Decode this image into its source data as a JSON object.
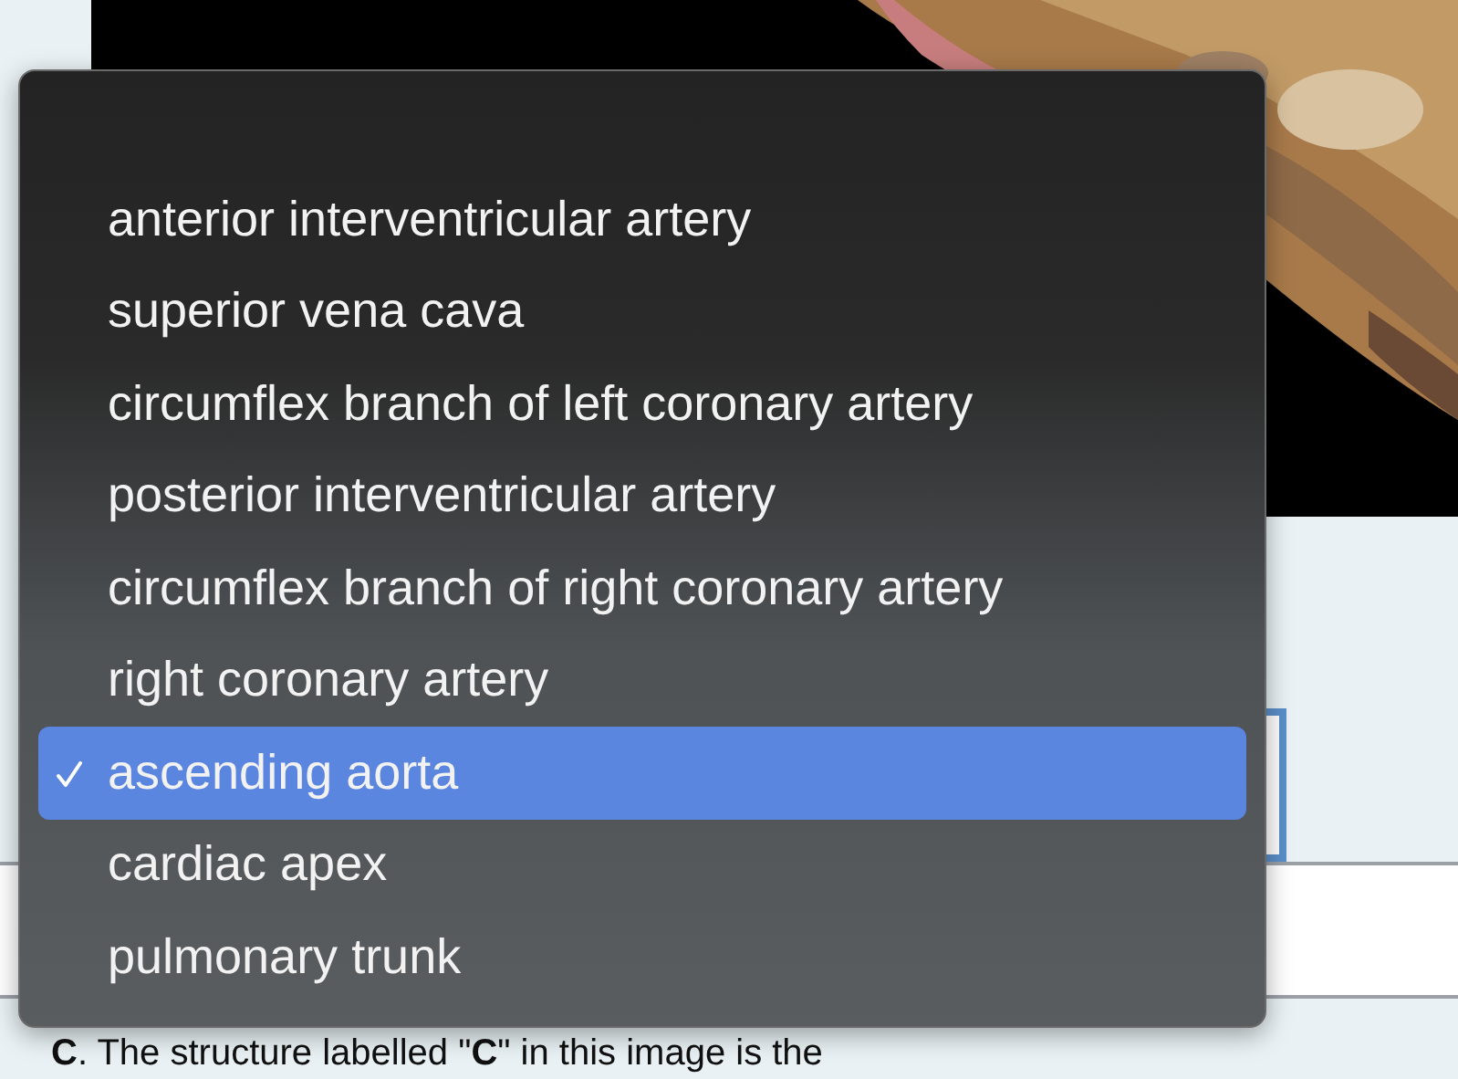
{
  "menu": {
    "options": [
      {
        "label": "anterior interventricular artery",
        "selected": false
      },
      {
        "label": "superior vena cava",
        "selected": false
      },
      {
        "label": "circumflex branch of left coronary artery",
        "selected": false
      },
      {
        "label": "posterior interventricular artery",
        "selected": false
      },
      {
        "label": "circumflex branch of right coronary artery",
        "selected": false
      },
      {
        "label": "right coronary artery",
        "selected": false
      },
      {
        "label": "ascending aorta",
        "selected": true
      },
      {
        "label": "cardiac apex",
        "selected": false
      },
      {
        "label": "pulmonary trunk",
        "selected": false
      }
    ]
  },
  "question": {
    "text": "**C**. The structure labelled \"**C**\" in this image is the"
  }
}
